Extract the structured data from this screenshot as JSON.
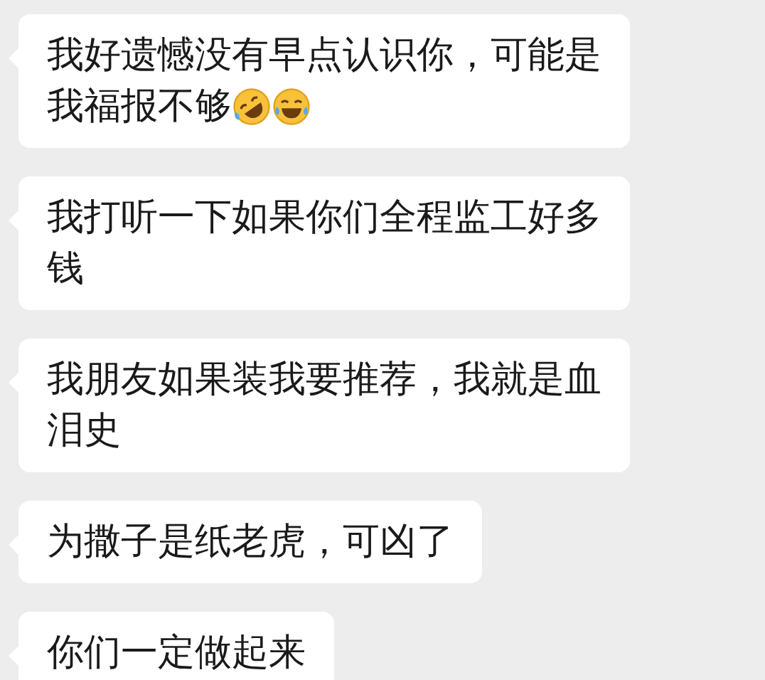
{
  "messages": [
    {
      "lines": [
        "我好遗憾没有早点认识你，可能是",
        "我福报不够"
      ],
      "emojis": [
        {
          "kind": "rolling-laughing"
        },
        {
          "kind": "tears-of-joy"
        }
      ]
    },
    {
      "lines": [
        "我打听一下如果你们全程监工好多",
        "钱"
      ]
    },
    {
      "lines": [
        "我朋友如果装我要推荐，我就是血",
        "泪史"
      ]
    },
    {
      "lines": [
        "为撒子是纸老虎，可凶了"
      ]
    },
    {
      "lines": [
        "你们一定做起来"
      ]
    }
  ]
}
